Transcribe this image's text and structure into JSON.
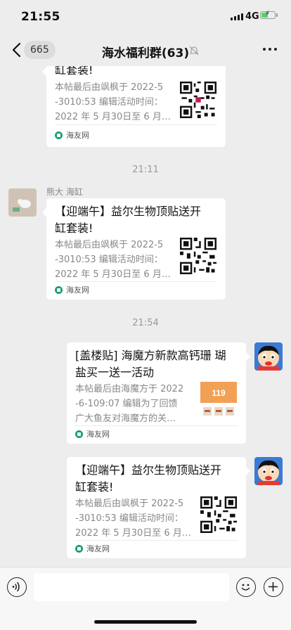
{
  "status": {
    "time": "21:55",
    "network": "4G"
  },
  "header": {
    "back_count": "665",
    "title": "海水福利群(63)"
  },
  "timestamps": [
    "21:11",
    "21:54"
  ],
  "messages": [
    {
      "sender": "",
      "title": "缸套装!",
      "desc_line1": "本帖最后由飒枫于 2022-5",
      "desc_line2": "-3010:53 编辑活动时间：",
      "desc_line3": "2022 年 5 月30日至 6 月…",
      "source": "海友网",
      "thumb": "qr-code"
    },
    {
      "sender": "熊大 海缸",
      "title_line1": "【迎端午】益尔生物顶贴送开",
      "title_line2": "缸套装!",
      "desc_line1": "本帖最后由飒枫于 2022-5",
      "desc_line2": "-3010:53 编辑活动时间：",
      "desc_line3": "2022 年 5 月30日至 6 月…",
      "source": "海友网",
      "thumb": "qr-code"
    },
    {
      "sender": "",
      "title_line1": "[盖楼贴] 海魔方新款高钙珊 瑚",
      "title_line2": "盐买一送一活动",
      "desc_line1": "本帖最后由海魔方于 2022",
      "desc_line2": "-6-109:07 编辑为了回馈",
      "desc_line3": "广大鱼友对海魔方的关…",
      "source": "海友网",
      "thumb": "product-photo",
      "thumb_text": "119"
    },
    {
      "sender": "",
      "title_line1": "【迎端午】益尔生物顶贴送开",
      "title_line2": "缸套装!",
      "desc_line1": "本帖最后由飒枫于 2022-5",
      "desc_line2": "-3010:53 编辑活动时间：",
      "desc_line3": "2022 年 5 月30日至 6 月…",
      "source": "海友网",
      "thumb": "qr-code"
    }
  ],
  "input": {
    "placeholder": ""
  },
  "colors": {
    "background": "#ededed",
    "bubble": "#ffffff",
    "source_icon": "#1a9e74",
    "battery": "#4cd964"
  }
}
